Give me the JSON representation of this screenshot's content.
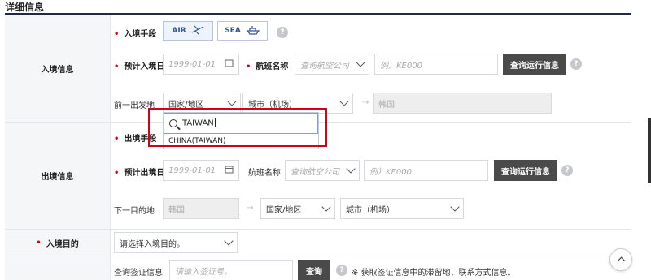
{
  "section": {
    "title": "详细信息"
  },
  "entry": {
    "row_label": "入境信息",
    "mode_label": "入境手段",
    "air_label": "AIR",
    "sea_label": "SEA",
    "date_label": "预计入境日",
    "date_placeholder": "1999-01-01",
    "flight_label": "航班名称",
    "airline_placeholder": "查询航空公司",
    "flight_placeholder": "例）KE000",
    "query_button": "查询运行信息",
    "origin_label": "前一出发地",
    "country_select": "国家/地区",
    "city_select": "城市（机场）",
    "destination_value": "韩国"
  },
  "dropdown": {
    "search_value": "TAIWAN",
    "options": [
      "CHINA(TAIWAN)"
    ]
  },
  "exit": {
    "row_label": "出境信息",
    "mode_label": "出境手段",
    "date_label": "预计出境日",
    "date_placeholder": "1999-01-01",
    "flight_label": "航班名称",
    "airline_placeholder": "查询航空公司",
    "flight_placeholder": "例）KE000",
    "query_button": "查询运行信息",
    "next_label": "下一目的地",
    "origin_value": "韩国",
    "country_select": "国家/地区",
    "city_select": "城市（机场）"
  },
  "purpose": {
    "row_label": "入境目的",
    "select_placeholder": "请选择入境目的。"
  },
  "visa": {
    "label": "查询签证信息",
    "input_placeholder": "请输入签证号。",
    "query_button": "查询",
    "note": "※ 获取签证信息中的滞留地、联系方式信息。"
  },
  "help_symbol": "?",
  "colors": {
    "accent": "#2f5597",
    "required": "#d0021b",
    "dark_button": "#4a4a4a",
    "highlight_box": "#d0021b"
  }
}
